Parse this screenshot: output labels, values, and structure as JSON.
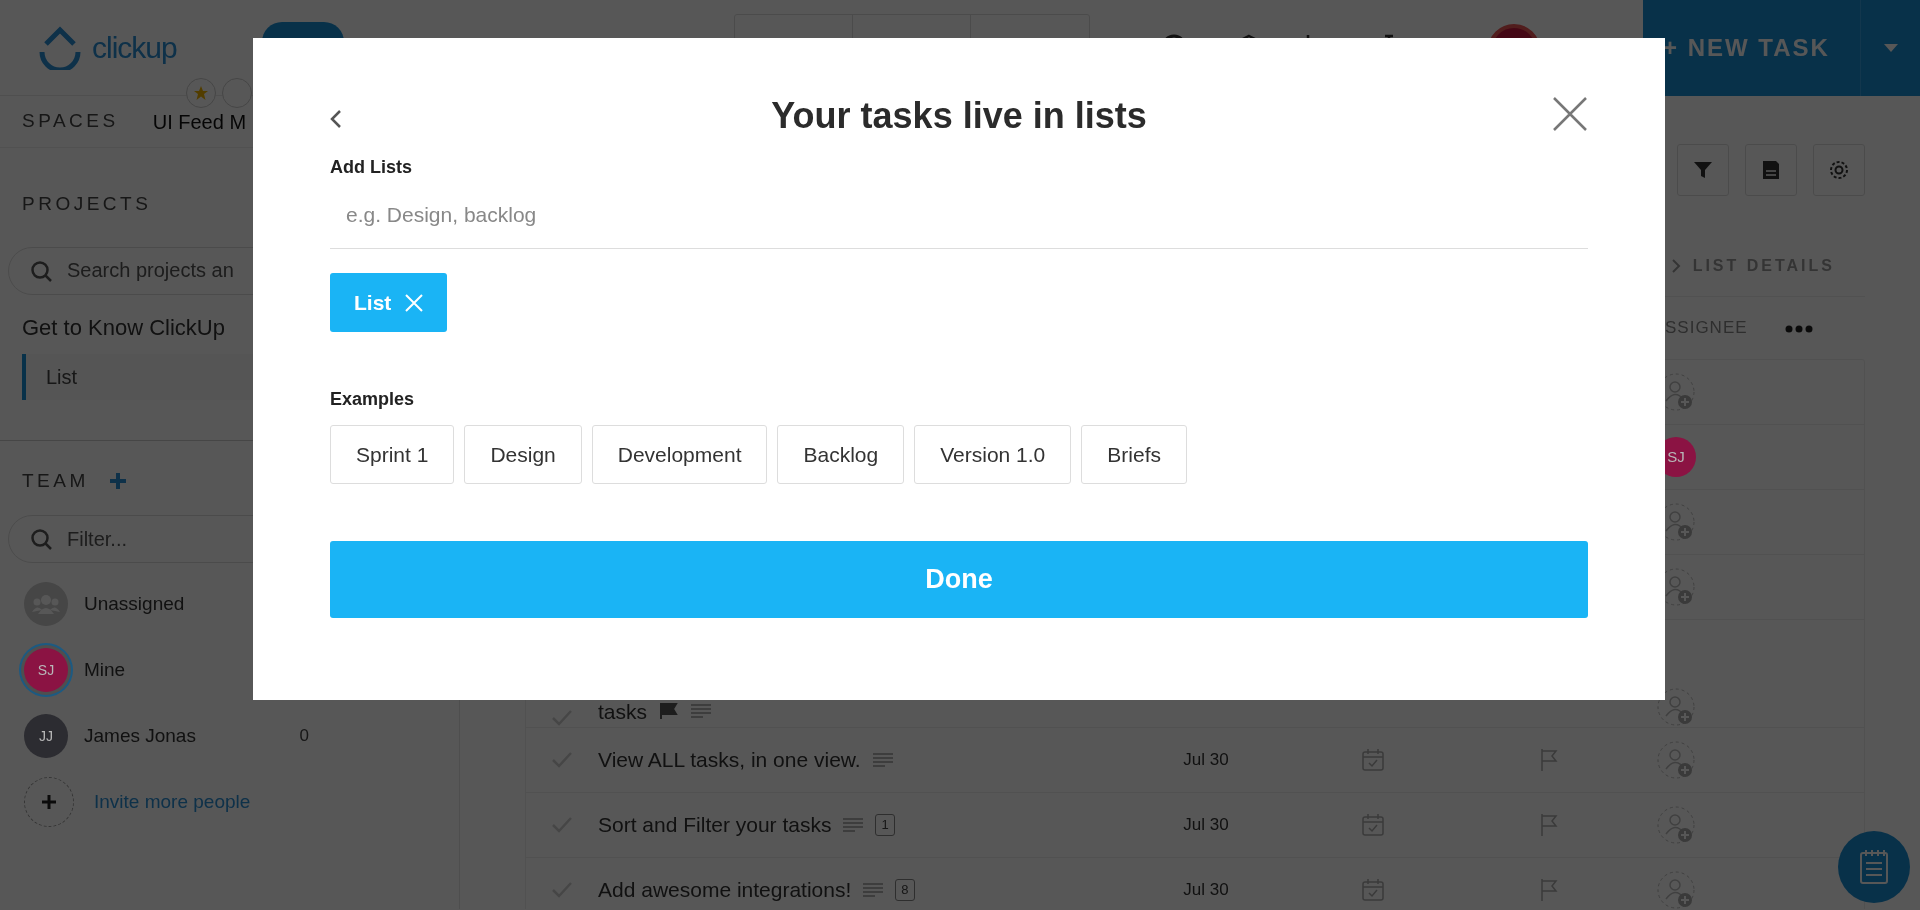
{
  "header": {
    "logo": "clickup",
    "new_task_button": "+ NEW TASK"
  },
  "sidebar": {
    "spaces_label": "SPACES",
    "space_name": "UI Feed M",
    "projects_label": "PROJECTS",
    "project_search": {
      "placeholder": "Search projects an"
    },
    "project": "Get to Know ClickUp",
    "lists": [
      {
        "label": "List",
        "selected": true
      }
    ],
    "team_label": "TEAM",
    "team_filter": {
      "placeholder": "Filter..."
    },
    "members": [
      {
        "kind": "group",
        "name": "Unassigned",
        "selected": false
      },
      {
        "kind": "avatar",
        "initials": "SJ",
        "name": "Mine",
        "color": "#8b1343",
        "selected": true
      },
      {
        "kind": "avatar",
        "initials": "JJ",
        "name": "James Jonas",
        "color": "#2c2c31",
        "count": "0",
        "selected": false
      }
    ],
    "invite": "Invite more people"
  },
  "main": {
    "list_details": "LIST DETAILS",
    "assignee_column": "SSIGNEE",
    "rows": [
      {
        "assignee": {
          "kind": "empty"
        }
      },
      {
        "assignee": {
          "kind": "avatar",
          "initials": "SJ",
          "color": "#8b1343"
        }
      },
      {
        "assignee": {
          "kind": "empty"
        }
      },
      {
        "assignee": {
          "kind": "empty"
        }
      },
      {
        "name": "tasks",
        "flag_icon": true,
        "description": true,
        "tall": true,
        "assignee": {
          "kind": "empty"
        }
      },
      {
        "name": "View ALL tasks, in one view.",
        "description": true,
        "due": "Jul 30",
        "assignee": {
          "kind": "empty"
        }
      },
      {
        "name": "Sort and Filter your tasks",
        "description": true,
        "subtasks": "1",
        "due": "Jul 30",
        "assignee": {
          "kind": "empty"
        }
      },
      {
        "name": "Add awesome integrations!",
        "description": true,
        "subtasks": "8",
        "due": "Jul 30",
        "assignee": {
          "kind": "empty"
        }
      }
    ]
  },
  "modal": {
    "title": "Your tasks live in lists",
    "add_label": "Add Lists",
    "list_input": {
      "placeholder": "e.g. Design, backlog"
    },
    "tags": [
      {
        "label": "List"
      }
    ],
    "examples_label": "Examples",
    "examples": [
      "Sprint 1",
      "Design",
      "Development",
      "Backlog",
      "Version 1.0",
      "Briefs"
    ],
    "done_button": "Done"
  }
}
